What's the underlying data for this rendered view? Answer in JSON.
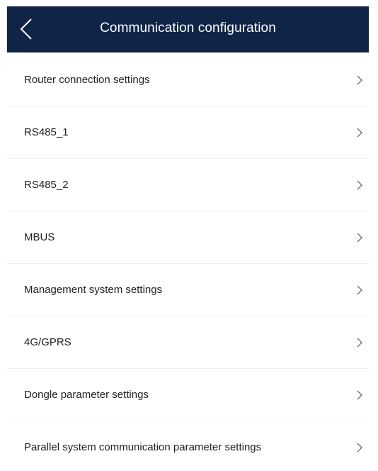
{
  "header": {
    "title": "Communication configuration",
    "background_color": "#0f2447",
    "back_icon": "chevron-left-icon"
  },
  "settings": {
    "items": [
      {
        "label": "Router connection settings",
        "icon": "chevron-right-icon"
      },
      {
        "label": "RS485_1",
        "icon": "chevron-right-icon"
      },
      {
        "label": "RS485_2",
        "icon": "chevron-right-icon"
      },
      {
        "label": "MBUS",
        "icon": "chevron-right-icon"
      },
      {
        "label": "Management system settings",
        "icon": "chevron-right-icon"
      },
      {
        "label": "4G/GPRS",
        "icon": "chevron-right-icon"
      },
      {
        "label": "Dongle parameter settings",
        "icon": "chevron-right-icon"
      },
      {
        "label": "Parallel system communication parameter settings",
        "icon": "chevron-right-icon"
      }
    ]
  }
}
